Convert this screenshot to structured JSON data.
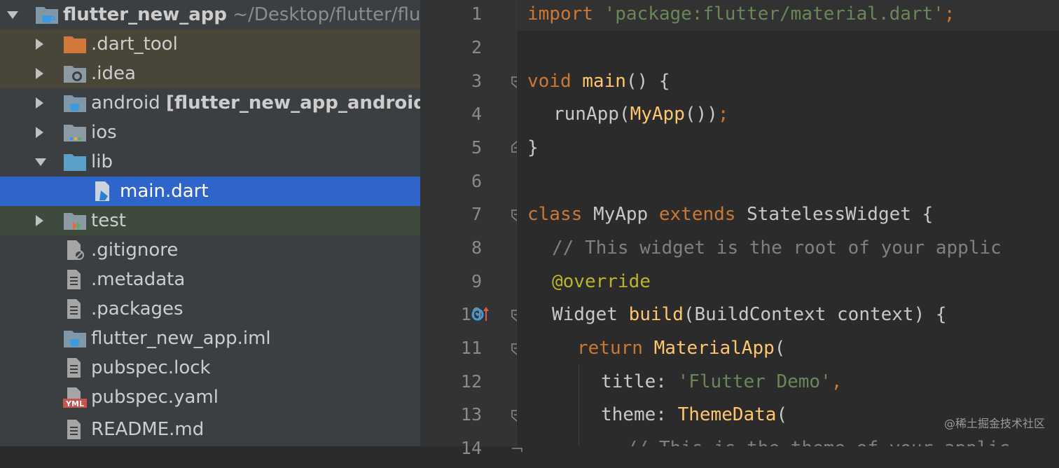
{
  "tree": {
    "root": {
      "name": "flutter_new_app",
      "path": "~/Desktop/flutter/flutte"
    },
    "items": [
      {
        "label": "dart_tool_label",
        "text": ".dart_tool"
      },
      {
        "text": ".idea"
      },
      {
        "text": "android",
        "suffix": "[flutter_new_app_android]"
      },
      {
        "text": "ios"
      },
      {
        "text": "lib"
      },
      {
        "text": "main.dart"
      },
      {
        "text": "test"
      },
      {
        "text": ".gitignore"
      },
      {
        "text": ".metadata"
      },
      {
        "text": ".packages"
      },
      {
        "text": "flutter_new_app.iml"
      },
      {
        "text": "pubspec.lock"
      },
      {
        "text": "pubspec.yaml"
      },
      {
        "text": "README.md"
      }
    ],
    "yml_badge": "YML"
  },
  "editor": {
    "line_numbers": [
      "1",
      "2",
      "3",
      "4",
      "5",
      "6",
      "7",
      "8",
      "9",
      "10",
      "11",
      "12",
      "13",
      "14"
    ],
    "lines": {
      "l1_kw": "import",
      "l1_str": "'package:flutter/material.dart'",
      "l1_end": ";",
      "l3_kw": "void",
      "l3_fn": "main",
      "l3_rest": "() {",
      "l4_a": "runApp(",
      "l4_fn": "MyApp",
      "l4_b": "())",
      "l4_end": ";",
      "l5": "}",
      "l7_kw": "class",
      "l7_cls": "MyApp",
      "l7_kw2": "extends",
      "l7_rest": "StatelessWidget {",
      "l8": "// This widget is the root of your applic",
      "l9_ann": "@",
      "l9_rest": "override",
      "l10_a": "Widget",
      "l10_fn": "build",
      "l10_b": "(BuildContext context) {",
      "l11_kw": "return",
      "l11_fn": "MaterialApp",
      "l11_b": "(",
      "l12_a": "title: ",
      "l12_str": "'Flutter Demo'",
      "l12_end": ",",
      "l13_a": "theme: ",
      "l13_fn": "ThemeData",
      "l13_b": "(",
      "l14": "// This is the theme of your applic"
    }
  },
  "watermark": "@稀土掘金技术社区",
  "colors": {
    "keyword": "#cc7832",
    "string": "#6a8759",
    "function": "#ffc66d",
    "selection": "#2f65ca"
  }
}
